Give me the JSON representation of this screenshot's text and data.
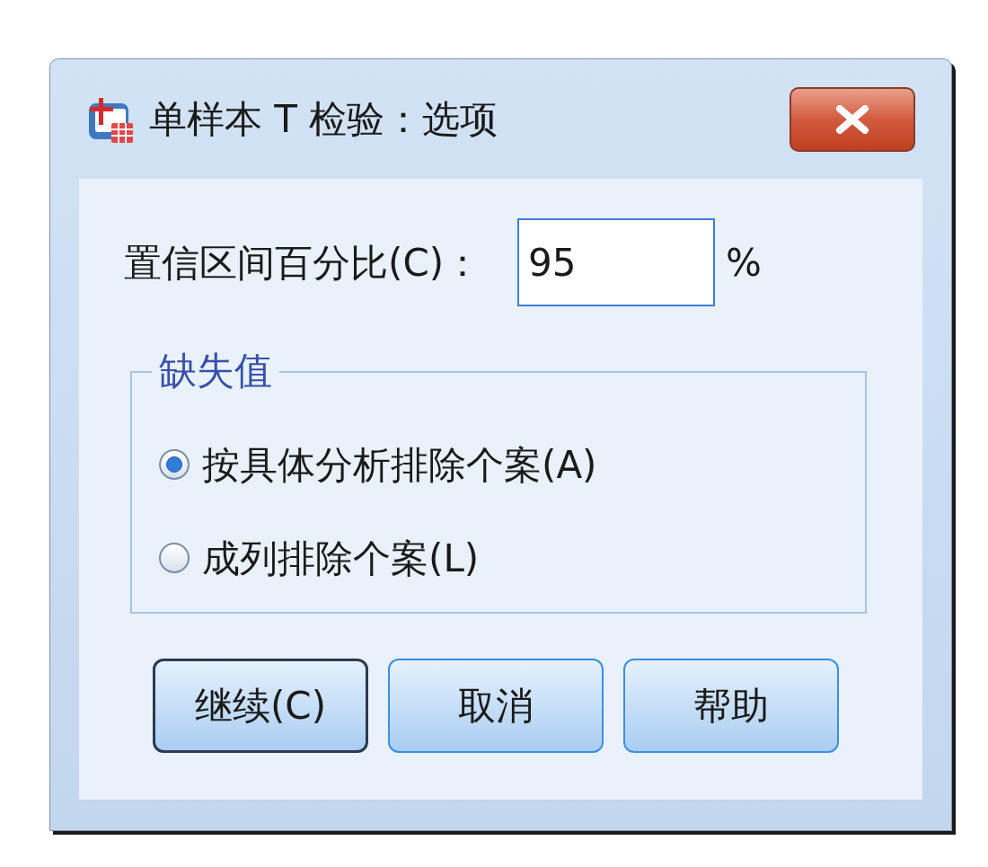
{
  "window": {
    "title": "单样本 T 检验：选项"
  },
  "confidence": {
    "label": "置信区间百分比(C)：",
    "value": "95",
    "unit": "%"
  },
  "missing_values": {
    "legend": "缺失值",
    "options": [
      {
        "label": "按具体分析排除个案(A)",
        "selected": true
      },
      {
        "label": "成列排除个案(L)",
        "selected": false
      }
    ]
  },
  "buttons": [
    {
      "label": "继续(C)",
      "default": true
    },
    {
      "label": "取消",
      "default": false
    },
    {
      "label": "帮助",
      "default": false
    }
  ]
}
